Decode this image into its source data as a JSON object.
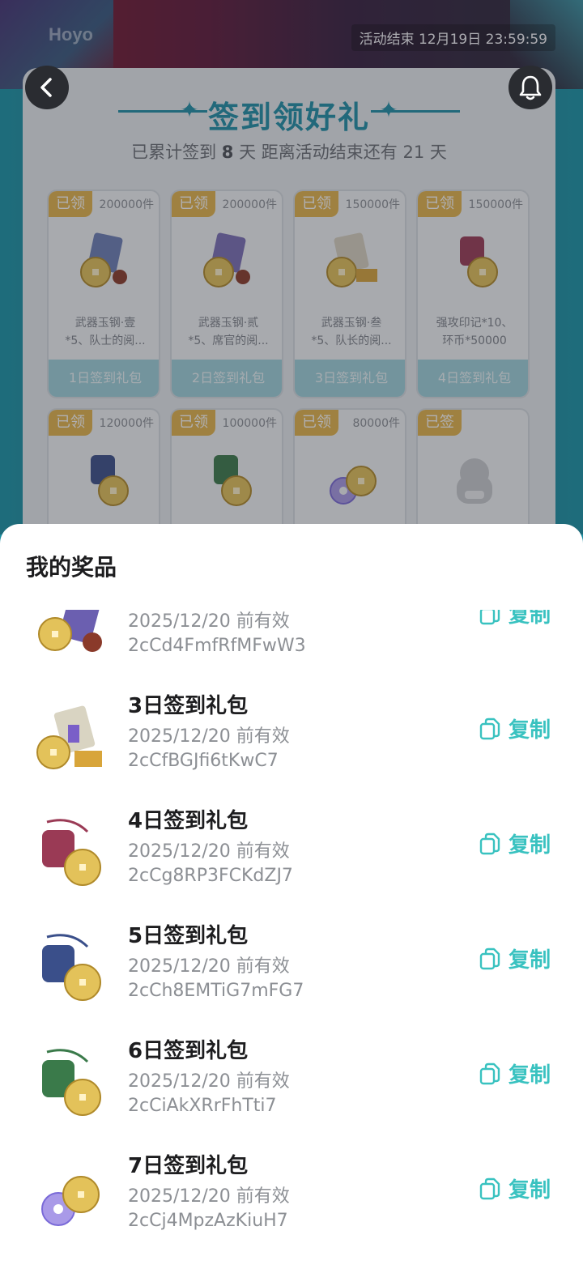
{
  "header": {
    "logo_text": "Hoyo",
    "end_time": "活动结束 12月19日 23:59:59"
  },
  "card": {
    "title": "签到领好礼",
    "sub_prefix": "已累计签到",
    "sub_days": "8",
    "sub_mid": "天  距离活动结束还有",
    "sub_remain": "21",
    "sub_suffix": "天"
  },
  "buttons": {
    "back_icon": "chevron-left-icon",
    "bell_icon": "bell-icon"
  },
  "gifts": [
    {
      "badge": "已领",
      "count": "200000件",
      "desc1": "武器玉钢·壹",
      "desc2": "*5、队士的阅...",
      "pkg": "1日签到礼包",
      "color": "#6b7fb8"
    },
    {
      "badge": "已领",
      "count": "200000件",
      "desc1": "武器玉钢·贰",
      "desc2": "*5、席官的阅...",
      "pkg": "2日签到礼包",
      "color": "#7a6fb8"
    },
    {
      "badge": "已领",
      "count": "150000件",
      "desc1": "武器玉钢·叁",
      "desc2": "*5、队长的阅...",
      "pkg": "3日签到礼包",
      "color": "#b8a36f"
    },
    {
      "badge": "已领",
      "count": "150000件",
      "desc1": "强攻印记*10、",
      "desc2": "环币*50000",
      "pkg": "4日签到礼包",
      "color": "#9a3a55"
    },
    {
      "badge": "已领",
      "count": "120000件",
      "desc1": "",
      "desc2": "",
      "pkg": "",
      "color": "#3a4f8a"
    },
    {
      "badge": "已领",
      "count": "100000件",
      "desc1": "",
      "desc2": "",
      "pkg": "",
      "color": "#3a7a4a"
    },
    {
      "badge": "已领",
      "count": "80000件",
      "desc1": "",
      "desc2": "",
      "pkg": "",
      "color": "#8a7ad8"
    },
    {
      "badge": "已签",
      "count": "",
      "desc1": "",
      "desc2": "",
      "pkg": "",
      "color": "#9aa0a6"
    }
  ],
  "sheet": {
    "title": "我的奖品",
    "copy_label": "复制",
    "prizes": [
      {
        "name": "",
        "date": "2025/12/20 前有效",
        "code": "2cCd4FmfRfMFwW3",
        "color": "#6b5fb0"
      },
      {
        "name": "3日签到礼包",
        "date": "2025/12/20 前有效",
        "code": "2cCfBGJfi6tKwC7",
        "color": "#b8a36f"
      },
      {
        "name": "4日签到礼包",
        "date": "2025/12/20 前有效",
        "code": "2cCg8RP3FCKdZJ7",
        "color": "#9a3a55"
      },
      {
        "name": "5日签到礼包",
        "date": "2025/12/20 前有效",
        "code": "2cCh8EMTiG7mFG7",
        "color": "#3a4f8a"
      },
      {
        "name": "6日签到礼包",
        "date": "2025/12/20 前有效",
        "code": "2cCiAkXRrFhTti7",
        "color": "#3a7a4a"
      },
      {
        "name": "7日签到礼包",
        "date": "2025/12/20 前有效",
        "code": "2cCj4MpzAzKiuH7",
        "color": "#8a7ad8"
      }
    ]
  },
  "colors": {
    "accent": "#39c2c0",
    "title_teal": "#1d8fa6",
    "badge_gold": "#e5b54a"
  }
}
